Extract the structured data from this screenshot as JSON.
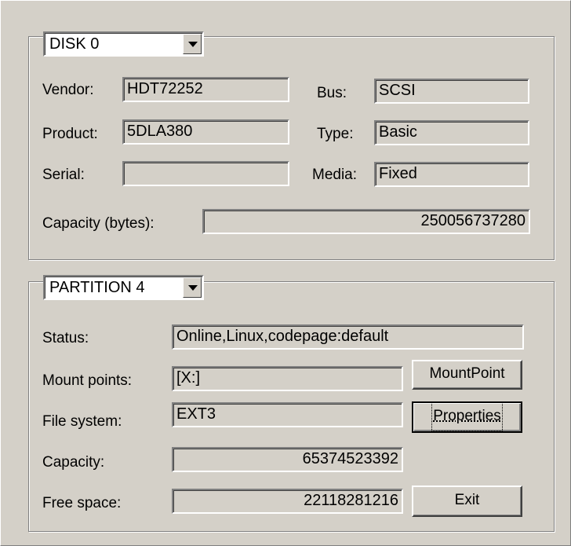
{
  "disk": {
    "selector_value": "DISK 0",
    "vendor_label": "Vendor:",
    "vendor_value": "HDT72252",
    "product_label": "Product:",
    "product_value": "5DLA380",
    "serial_label": "Serial:",
    "serial_value": "",
    "bus_label": "Bus:",
    "bus_value": "SCSI",
    "type_label": "Type:",
    "type_value": "Basic",
    "media_label": "Media:",
    "media_value": "Fixed",
    "capacity_label": "Capacity (bytes):",
    "capacity_value": "250056737280"
  },
  "partition": {
    "selector_value": "PARTITION 4",
    "status_label": "Status:",
    "status_value": "Online,Linux,codepage:default",
    "mount_label": "Mount points:",
    "mount_value": "[X:]",
    "fs_label": "File system:",
    "fs_value": "EXT3",
    "capacity_label": "Capacity:",
    "capacity_value": "65374523392",
    "free_label": "Free space:",
    "free_value": "22118281216"
  },
  "buttons": {
    "mountpoint": "MountPoint",
    "properties": "Properties",
    "exit": "Exit"
  }
}
